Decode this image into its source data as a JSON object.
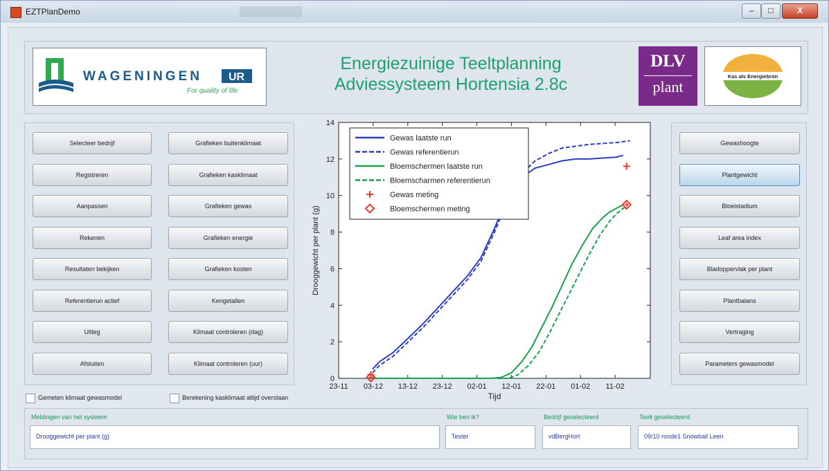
{
  "window": {
    "title": "EZTPlanDemo",
    "min": "–",
    "max": "□",
    "close": "X"
  },
  "header": {
    "title_line1": "Energiezuinige Teeltplanning",
    "title_line2": "Adviessysteem Hortensia 2.8c",
    "logo_wur_main": "WAGENINGEN",
    "logo_wur_badge": "UR",
    "logo_wur_tagline": "For quality of life",
    "logo_dlv_top": "DLV",
    "logo_dlv_bottom": "plant",
    "logo_kas": "Kas als Energiebron"
  },
  "left_buttons_col1": [
    "Selecteer bedrijf",
    "Registreren",
    "Aanpassen",
    "Rekenen",
    "Resultaten bekijken",
    "Referentierun actief",
    "Uitleg",
    "Afsluiten"
  ],
  "left_buttons_col2": [
    "Grafieken buitenklimaat",
    "Grafieken kasklimaat",
    "Grafieken gewas",
    "Grafieken energie",
    "Grafieken kosten",
    "Kengetallen",
    "Klimaat controleren (dag)",
    "Klimaat controleren (uur)"
  ],
  "right_buttons": [
    "Gewashoogte",
    "Plantgewicht",
    "Bloeistadium",
    "Leaf area index",
    "Bladoppervlak per plant",
    "Plantbalans",
    "Vertraging",
    "Parameters gewasmodel"
  ],
  "active_right_button": "Plantgewicht",
  "checkboxes": [
    {
      "label": "Gemeten klimaat gewasmodel",
      "checked": false
    },
    {
      "label": "Berekening kasklimaat altijd overslaan",
      "checked": false
    }
  ],
  "footer": {
    "messages_label": "Meldingen van het systeem",
    "messages_value": "Drooggewicht per plant (g)",
    "who_label": "Wie ben ik?",
    "who_value": "Tester",
    "company_label": "Bedrijf geselecteerd",
    "company_value": "vdBergHort",
    "crop_label": "Teelt geselecteerd",
    "crop_value": "09/10 ronde1 Snowball Leen"
  },
  "chart_data": {
    "type": "line",
    "xlabel": "Tijd",
    "ylabel": "Drooggewicht per plant (g)",
    "ylim": [
      0,
      14
    ],
    "yticks": [
      0,
      2,
      4,
      6,
      8,
      10,
      12,
      14
    ],
    "xlim": [
      0,
      92
    ],
    "xticks": [
      "23-11",
      "03-12",
      "13-12",
      "23-12",
      "02-01",
      "12-01",
      "22-01",
      "01-02",
      "11-02"
    ],
    "x_unit": "days since 23-11",
    "legend_position": "top-left",
    "series": [
      {
        "name": "Gewas laatste run",
        "style": "solid",
        "color": "#2b3fc0",
        "x": [
          10,
          12,
          16,
          20,
          25,
          30,
          35,
          38,
          42,
          46,
          48,
          50,
          54,
          58,
          62,
          66,
          70,
          74,
          78,
          82,
          84
        ],
        "y": [
          0.5,
          0.9,
          1.4,
          2.1,
          3.0,
          4.0,
          5.0,
          5.6,
          6.6,
          8.2,
          9.1,
          10.1,
          11.0,
          11.5,
          11.7,
          11.9,
          12.0,
          12.0,
          12.05,
          12.1,
          12.2
        ]
      },
      {
        "name": "Gewas referentierun",
        "style": "dashed",
        "color": "#2b3fc0",
        "x": [
          10,
          12,
          16,
          20,
          25,
          30,
          35,
          38,
          42,
          46,
          48,
          50,
          54,
          58,
          62,
          66,
          70,
          74,
          78,
          82,
          86
        ],
        "y": [
          0.3,
          0.7,
          1.2,
          1.9,
          2.8,
          3.8,
          4.8,
          5.4,
          6.4,
          8.0,
          8.9,
          9.9,
          11.2,
          11.9,
          12.3,
          12.6,
          12.7,
          12.8,
          12.85,
          12.9,
          13.0
        ]
      },
      {
        "name": "Bloemscherm laatste run",
        "style": "solid",
        "color": "#16a34a",
        "x": [
          10,
          20,
          30,
          40,
          45,
          48,
          51,
          54,
          57,
          60,
          63,
          66,
          69,
          72,
          75,
          78,
          80,
          82,
          84
        ],
        "y": [
          0,
          0,
          0,
          0,
          0,
          0.05,
          0.3,
          0.9,
          1.7,
          2.8,
          3.9,
          5.1,
          6.3,
          7.3,
          8.2,
          8.8,
          9.1,
          9.3,
          9.5
        ]
      },
      {
        "name": "Bloemscherm referentierun",
        "style": "dashed",
        "color": "#16a34a",
        "x": [
          10,
          20,
          30,
          40,
          45,
          50,
          53,
          56,
          59,
          62,
          65,
          68,
          71,
          74,
          77,
          80,
          82,
          84,
          85
        ],
        "y": [
          0,
          0,
          0,
          0,
          0,
          0,
          0.2,
          0.7,
          1.4,
          2.4,
          3.5,
          4.6,
          5.7,
          6.8,
          7.8,
          8.6,
          9.0,
          9.3,
          9.4
        ]
      },
      {
        "name": "Gewas meting",
        "style": "marker-plus",
        "color": "#e53b2b",
        "x": [
          9.5,
          85
        ],
        "y": [
          0.2,
          11.6
        ]
      },
      {
        "name": "Bloemscherm meting",
        "style": "marker-diamond",
        "color": "#e53b2b",
        "x": [
          9.5,
          85
        ],
        "y": [
          0.05,
          9.5
        ]
      }
    ],
    "legend_labels": [
      "Gewas laatste run",
      "Gewas referentierun",
      "Bloemschermen laatste run",
      "Bloemscharmen referentierun",
      "Gewas meting",
      "Bloemschermen meting"
    ]
  }
}
